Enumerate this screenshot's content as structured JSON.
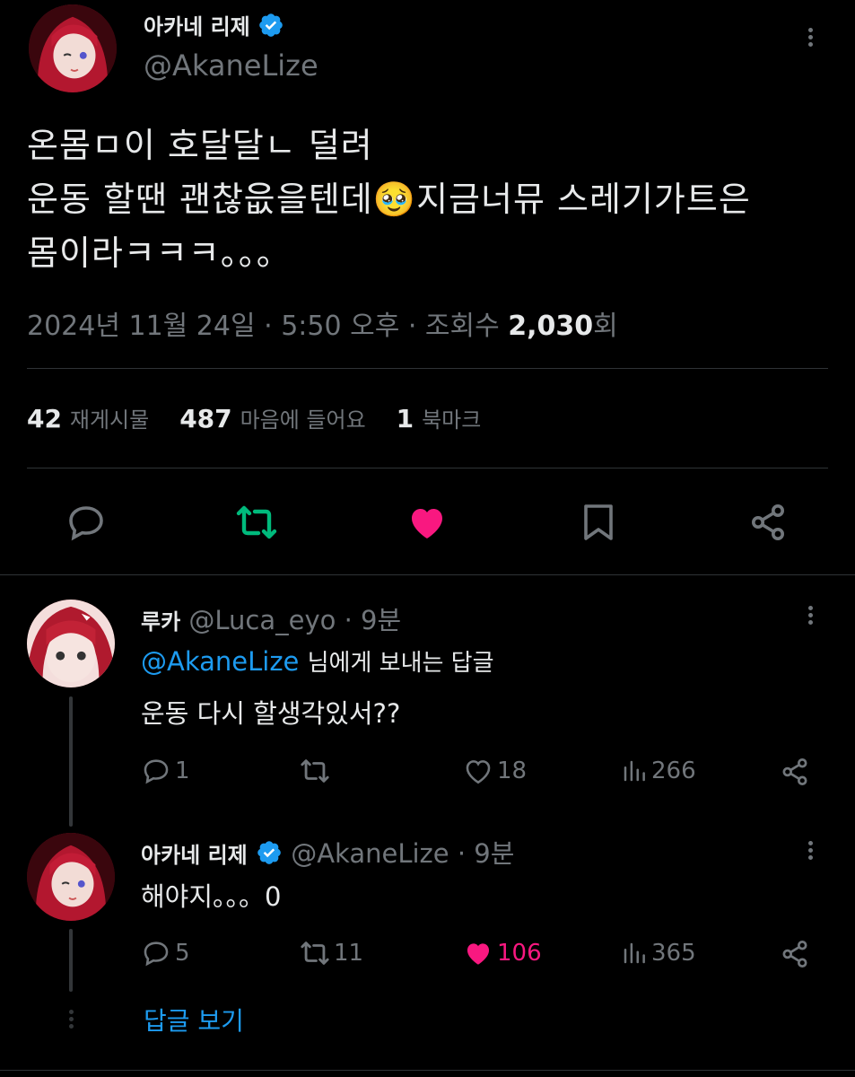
{
  "main_post": {
    "author_name": "아카네 리제",
    "author_handle": "@AkaneLize",
    "text_line1": "온몸ㅁ이 호달달ㄴ 덜려",
    "text_line2a": "운동 할땐 괜찮읎을텐데",
    "emoji": "🥹",
    "text_line2b": "지금너뮤 스레기가트은",
    "text_line3": "몸이라ㅋㅋㅋ。。。",
    "date": "2024년 11월 24일",
    "time": "5:50 오후",
    "views_label": "조회수",
    "views": "2,030",
    "views_suffix": "회",
    "stats": {
      "reposts": "42",
      "reposts_label": "재게시물",
      "likes": "487",
      "likes_label": "마음에 들어요",
      "bookmarks": "1",
      "bookmarks_label": "북마크"
    },
    "colors": {
      "repost_active": "#00ba7c",
      "like_active": "#f91880"
    }
  },
  "replies": [
    {
      "author_name": "루카",
      "author_handle": "@Luca_eyo",
      "time": "9분",
      "replying_to": "@AkaneLize",
      "replying_suffix": "님에게 보내는 답글",
      "text": "운동 다시 할생각있서??",
      "comments": "1",
      "reposts": "",
      "likes": "18",
      "views": "266"
    },
    {
      "author_name": "아카네 리제",
      "author_handle": "@AkaneLize",
      "time": "9분",
      "text": "해야지。。。0",
      "comments": "5",
      "reposts": "11",
      "likes": "106",
      "views": "365"
    }
  ],
  "show_replies": "답글 보기",
  "icons": [
    "verified-badge-icon",
    "more-icon",
    "reply-icon",
    "repost-icon",
    "heart-icon",
    "bookmark-icon",
    "share-icon",
    "views-icon"
  ]
}
